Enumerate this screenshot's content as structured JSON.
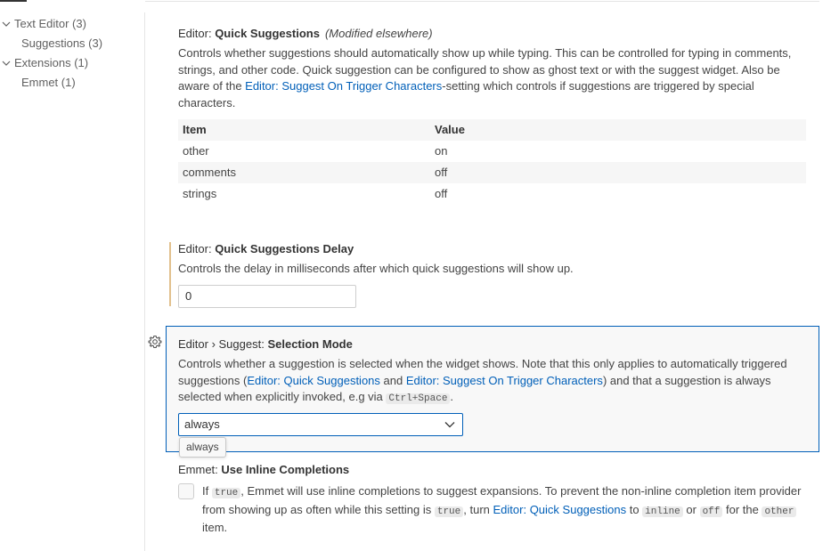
{
  "toc": {
    "items": [
      {
        "label": "Text Editor (3)",
        "expanded": true,
        "level": 0
      },
      {
        "label": "Suggestions (3)",
        "level": 1
      },
      {
        "label": "Extensions (1)",
        "expanded": true,
        "level": 0
      },
      {
        "label": "Emmet (1)",
        "level": 1
      }
    ]
  },
  "settings": {
    "quick_suggestions": {
      "category": "Editor: ",
      "key": "Quick Suggestions",
      "modified": "(Modified elsewhere)",
      "desc_1": "Controls whether suggestions should automatically show up while typing. This can be controlled for typing in comments, strings, and other code. Quick suggestion can be configured to show as ghost text or with the suggest widget. Also be aware of the ",
      "desc_link": "Editor: Suggest On Trigger Characters",
      "desc_2": "-setting which controls if suggestions are triggered by special characters.",
      "table": {
        "headers": [
          "Item",
          "Value"
        ],
        "rows": [
          [
            "other",
            "on"
          ],
          [
            "comments",
            "off"
          ],
          [
            "strings",
            "off"
          ]
        ]
      }
    },
    "quick_suggestions_delay": {
      "category": "Editor: ",
      "key": "Quick Suggestions Delay",
      "desc": "Controls the delay in milliseconds after which quick suggestions will show up.",
      "value": "0"
    },
    "selection_mode": {
      "category": "Editor › Suggest: ",
      "key": "Selection Mode",
      "desc_1": "Controls whether a suggestion is selected when the widget shows. Note that this only applies to automatically triggered suggestions (",
      "link_1": "Editor: Quick Suggestions",
      "desc_2": " and ",
      "link_2": "Editor: Suggest On Trigger Characters",
      "desc_3": ") and that a suggestion is always selected when explicitly invoked, e.g via ",
      "keybinding": "Ctrl+Space",
      "desc_4": ".",
      "selected": "always",
      "hover_text": "always"
    },
    "emmet_inline": {
      "category": "Emmet: ",
      "key": "Use Inline Completions",
      "desc_1": "If ",
      "code_1": "true",
      "desc_2": ", Emmet will use inline completions to suggest expansions. To prevent the non-inline completion item provider from showing up as often while this setting is ",
      "code_2": "true",
      "desc_3": ", turn ",
      "link": "Editor: Quick Suggestions",
      "desc_4": " to ",
      "code_3": "inline",
      "desc_5": " or ",
      "code_4": "off",
      "desc_6": " for the ",
      "code_5": "other",
      "desc_7": " item.",
      "checked": false
    }
  },
  "colors": {
    "link": "#005fb8",
    "focus_border": "#005fb8",
    "modified_indicator": "#e2c08d"
  }
}
